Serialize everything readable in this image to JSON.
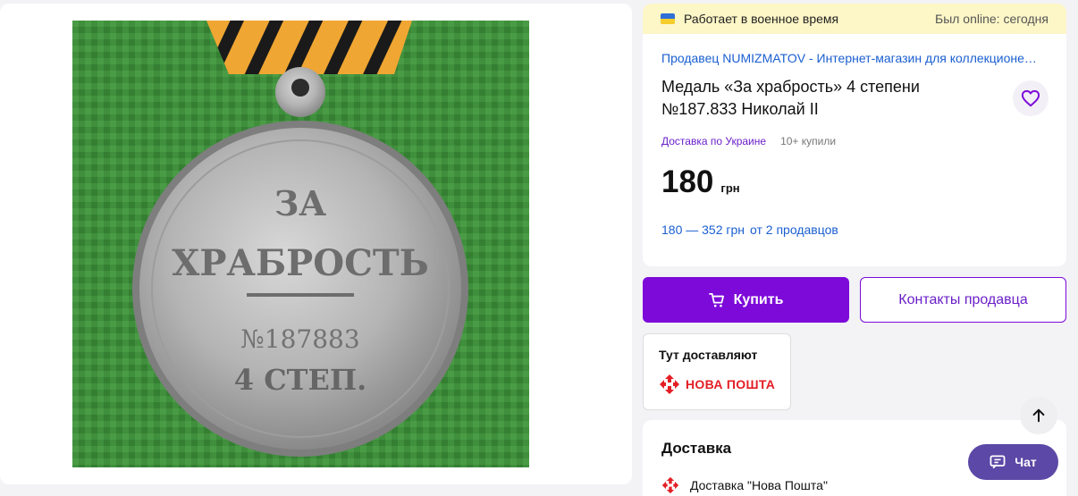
{
  "banner": {
    "status_text": "Работает в военное время",
    "online_text": "Был online: сегодня",
    "flag_icon": "ukraine-flag-icon"
  },
  "product": {
    "seller": "Продавец NUMIZMATOV - Интернет-магазин для коллекционе…",
    "title": "Медаль «За храбрость» 4 степени №187.833 Николай II",
    "delivery_tag": "Доставка по Украине",
    "bought": "10+ купили",
    "price": "180",
    "currency": "грн",
    "range_text": "180 — 352 грн",
    "sellers_text": "от 2 продавцов"
  },
  "photo": {
    "medal_line1": "ЗА",
    "medal_line2": "ХРАБРОСТЬ",
    "medal_number": "№187883",
    "medal_degree": "4 СТЕП."
  },
  "actions": {
    "buy_label": "Купить",
    "contact_label": "Контакты продавца",
    "chat_label": "Чат"
  },
  "shipping_badge": {
    "title": "Тут доставляют",
    "brand": "НОВА ПОШТА"
  },
  "delivery": {
    "title": "Доставка",
    "option": "Доставка \"Нова Пошта\""
  },
  "colors": {
    "accent": "#7d0ad9",
    "link": "#1a5fd0",
    "nova_poshta": "#e31e24",
    "banner_bg": "#fdf6c7",
    "chat": "#5c48a6"
  }
}
